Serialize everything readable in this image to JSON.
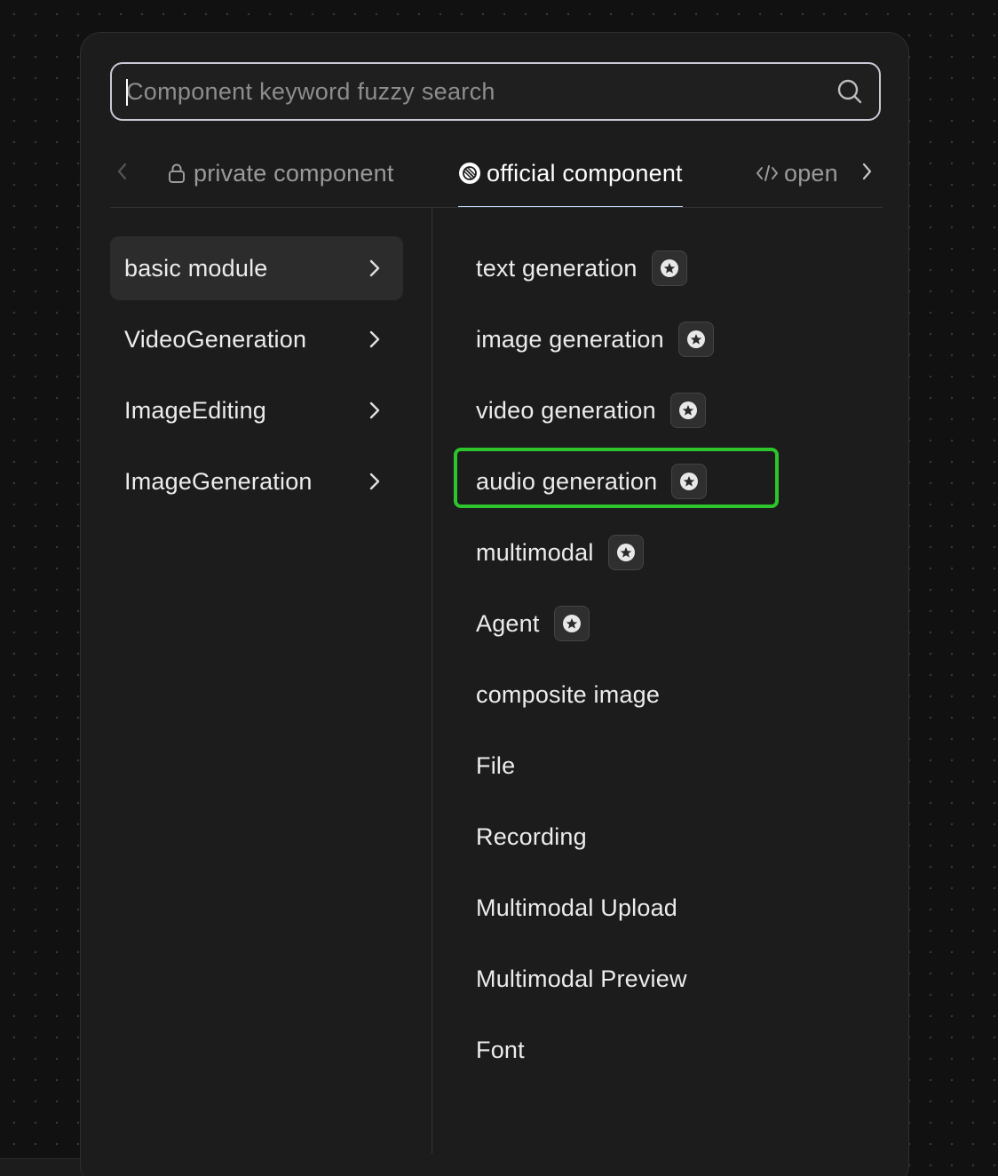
{
  "search": {
    "placeholder": "Component keyword fuzzy search",
    "value": ""
  },
  "tabs": [
    {
      "label": "private component",
      "icon": "lock-icon",
      "state": "inactive"
    },
    {
      "label": "official component",
      "icon": "official-badge-icon",
      "state": "active"
    },
    {
      "label": "open",
      "icon": "code-icon",
      "state": "inactive"
    }
  ],
  "categories": [
    {
      "label": "basic module",
      "active": true
    },
    {
      "label": "VideoGeneration",
      "active": false
    },
    {
      "label": "ImageEditing",
      "active": false
    },
    {
      "label": "ImageGeneration",
      "active": false
    }
  ],
  "components": [
    {
      "label": "text generation",
      "badge": true
    },
    {
      "label": "image generation",
      "badge": true
    },
    {
      "label": "video generation",
      "badge": true
    },
    {
      "label": "audio generation",
      "badge": true,
      "highlighted": true
    },
    {
      "label": "multimodal",
      "badge": true
    },
    {
      "label": "Agent",
      "badge": true
    },
    {
      "label": "composite image",
      "badge": false
    },
    {
      "label": "File",
      "badge": false
    },
    {
      "label": "Recording",
      "badge": false
    },
    {
      "label": "Multimodal Upload",
      "badge": false
    },
    {
      "label": "Multimodal Preview",
      "badge": false
    },
    {
      "label": "Font",
      "badge": false
    }
  ],
  "colors": {
    "highlight": "#2cc52c",
    "active_tab_underline": "#bcd0f5",
    "search_border": "#c9c9d6"
  }
}
